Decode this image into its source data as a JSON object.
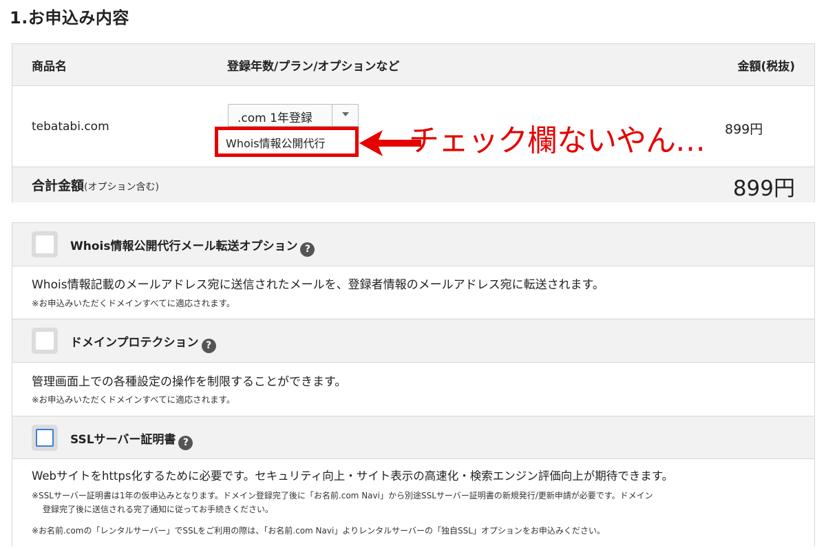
{
  "section_title": "1.お申込み内容",
  "order": {
    "headers": {
      "product": "商品名",
      "plan": "登録年数/プラン/オプションなど",
      "price": "金額(税抜)"
    },
    "row": {
      "domain": "tebatabi.com",
      "plan_selected": ".com 1年登録",
      "whois_option": "Whois情報公開代行",
      "price": "899円"
    },
    "total": {
      "label": "合計金額",
      "note": "(オプション含む)",
      "value": "899円"
    }
  },
  "annotation": {
    "text": "チェック欄ないやん…",
    "color": "#e60000"
  },
  "options": [
    {
      "title": "Whois情報公開代行メール転送オプション",
      "checked": false,
      "description": "Whois情報記載のメールアドレス宛に送信されたメールを、登録者情報のメールアドレス宛に転送されます。",
      "notes": [
        "※お申込みいただくドメインすべてに適応されます。"
      ]
    },
    {
      "title": "ドメインプロテクション",
      "checked": false,
      "description": "管理画面上での各種設定の操作を制限することができます。",
      "notes": [
        "※お申込みいただくドメインすべてに適応されます。"
      ]
    },
    {
      "title": "SSLサーバー証明書",
      "checked": false,
      "description": "Webサイトをhttps化するために必要です。セキュリティ向上・サイト表示の高速化・検索エンジン評価向上が期待できます。",
      "notes": [
        "※SSLサーバー証明書は1年の仮申込みとなります。ドメイン登録完了後に「お名前.com Navi」から別途SSLサーバー証明書の新規発行/更新申請が必要です。ドメイン",
        "登録完了後に送信される完了通知に従ってお手続きください。",
        "※お名前.comの「レンタルサーバー」でSSLをご利用の際は、「お名前.com Navi」よりレンタルサーバーの「独自SSL」オプションをお申込みください。"
      ]
    }
  ],
  "help_icon_glyph": "?",
  "colors": {
    "accent_red": "#e60000",
    "checkbox_focus": "#3b7fd9",
    "header_bg": "#f2f2f2"
  }
}
